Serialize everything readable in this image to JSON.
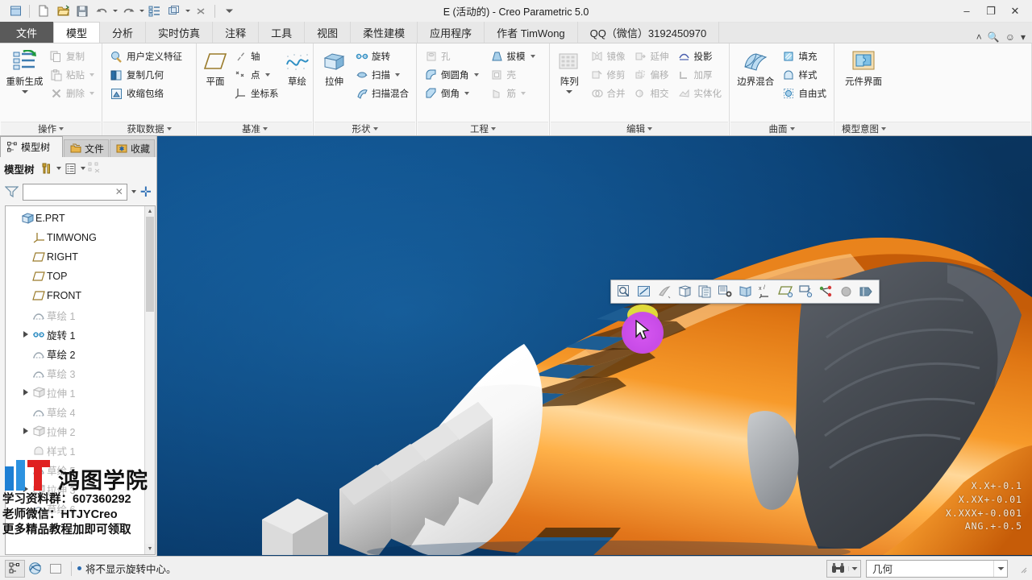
{
  "window": {
    "title": "E (活动的) - Creo Parametric 5.0",
    "minimize": "–",
    "maximize": "❐",
    "close": "✕"
  },
  "quick_access": [
    {
      "name": "app-icon",
      "icon": "cube-icon"
    },
    {
      "name": "new-file",
      "icon": "new-document-icon"
    },
    {
      "name": "open-file",
      "icon": "open-folder-icon"
    },
    {
      "name": "save-file",
      "icon": "save-disk-icon"
    },
    {
      "name": "undo",
      "icon": "undo-arrow-icon"
    },
    {
      "name": "redo",
      "icon": "redo-arrow-icon"
    },
    {
      "name": "regenerate",
      "icon": "regenerate-icon"
    },
    {
      "name": "window-switch",
      "icon": "window-icon"
    },
    {
      "name": "close-window",
      "icon": "close-x-icon"
    },
    {
      "name": "customize-qat",
      "icon": "chevron-down-icon"
    }
  ],
  "tabs": [
    {
      "label": "文件",
      "kind": "file"
    },
    {
      "label": "模型",
      "kind": "active"
    },
    {
      "label": "分析",
      "kind": "normal"
    },
    {
      "label": "实时仿真",
      "kind": "normal"
    },
    {
      "label": "注释",
      "kind": "normal"
    },
    {
      "label": "工具",
      "kind": "normal"
    },
    {
      "label": "视图",
      "kind": "normal"
    },
    {
      "label": "柔性建模",
      "kind": "normal"
    },
    {
      "label": "应用程序",
      "kind": "normal"
    },
    {
      "label": "作者 TimWong",
      "kind": "normal"
    },
    {
      "label": "QQ（微信）3192450970",
      "kind": "normal"
    }
  ],
  "tabbar_right": [
    "˄",
    "🔍",
    "☺",
    "▾"
  ],
  "ribbon": {
    "groups": [
      {
        "title": "操作",
        "big": {
          "label": "重新生成",
          "icon": "regenerate-icon",
          "has_dropdown": true
        },
        "items": [
          {
            "label": "复制",
            "icon": "copy-icon",
            "dimmed": true,
            "dropdown": false
          },
          {
            "label": "粘贴",
            "icon": "paste-icon",
            "dimmed": true,
            "dropdown": true
          },
          {
            "label": "删除",
            "icon": "delete-x-icon",
            "dimmed": true,
            "dropdown": true
          }
        ]
      },
      {
        "title": "获取数据",
        "items": [
          {
            "label": "用户定义特征",
            "icon": "udf-icon",
            "dimmed": false,
            "dropdown": false
          },
          {
            "label": "复制几何",
            "icon": "copy-geometry-icon",
            "dimmed": false,
            "dropdown": false
          },
          {
            "label": "收缩包络",
            "icon": "shrinkwrap-icon",
            "dimmed": false,
            "dropdown": false
          }
        ]
      },
      {
        "title": "基准",
        "big": {
          "label": "平面",
          "icon": "datum-plane-icon",
          "has_dropdown": false
        },
        "items": [
          {
            "label": "轴",
            "icon": "datum-axis-icon",
            "dimmed": false,
            "dropdown": false
          },
          {
            "label": "点",
            "icon": "datum-point-icon",
            "dimmed": false,
            "dropdown": true
          },
          {
            "label": "坐标系",
            "icon": "coordinate-system-icon",
            "dimmed": false,
            "dropdown": false
          }
        ],
        "big2": {
          "label": "草绘",
          "icon": "sketch-curve-icon",
          "has_dropdown": false
        }
      },
      {
        "title": "形状",
        "big": {
          "label": "拉伸",
          "icon": "extrude-icon",
          "has_dropdown": false
        },
        "items": [
          {
            "label": "旋转",
            "icon": "revolve-icon",
            "dimmed": false,
            "dropdown": false
          },
          {
            "label": "扫描",
            "icon": "sweep-icon",
            "dimmed": false,
            "dropdown": true
          },
          {
            "label": "扫描混合",
            "icon": "swept-blend-icon",
            "dimmed": false,
            "dropdown": false
          }
        ]
      },
      {
        "title": "工程",
        "col1": [
          {
            "label": "孔",
            "icon": "hole-icon",
            "dimmed": true,
            "dropdown": false
          },
          {
            "label": "倒圆角",
            "icon": "round-icon",
            "dimmed": false,
            "dropdown": true
          },
          {
            "label": "倒角",
            "icon": "chamfer-icon",
            "dimmed": false,
            "dropdown": true
          }
        ],
        "col2": [
          {
            "label": "拔模",
            "icon": "draft-icon",
            "dimmed": false,
            "dropdown": true
          },
          {
            "label": "壳",
            "icon": "shell-icon",
            "dimmed": true,
            "dropdown": false
          },
          {
            "label": "筋",
            "icon": "rib-icon",
            "dimmed": true,
            "dropdown": true
          }
        ]
      },
      {
        "title": "编辑",
        "big": {
          "label": "阵列",
          "icon": "pattern-icon",
          "has_dropdown": true
        },
        "col1": [
          {
            "label": "镜像",
            "icon": "mirror-icon",
            "dimmed": true,
            "dropdown": false
          },
          {
            "label": "修剪",
            "icon": "trim-icon",
            "dimmed": true,
            "dropdown": false
          },
          {
            "label": "合并",
            "icon": "merge-icon",
            "dimmed": true,
            "dropdown": false
          }
        ],
        "col2": [
          {
            "label": "延伸",
            "icon": "extend-icon",
            "dimmed": true,
            "dropdown": false
          },
          {
            "label": "偏移",
            "icon": "offset-icon",
            "dimmed": true,
            "dropdown": false
          },
          {
            "label": "相交",
            "icon": "intersect-icon",
            "dimmed": true,
            "dropdown": false
          }
        ],
        "col3": [
          {
            "label": "投影",
            "icon": "project-icon",
            "dimmed": false,
            "dropdown": false
          },
          {
            "label": "加厚",
            "icon": "thicken-icon",
            "dimmed": true,
            "dropdown": false
          },
          {
            "label": "实体化",
            "icon": "solidify-icon",
            "dimmed": true,
            "dropdown": false
          }
        ]
      },
      {
        "title": "曲面",
        "big": {
          "label": "边界混合",
          "icon": "boundary-blend-icon",
          "has_dropdown": false
        },
        "items": [
          {
            "label": "填充",
            "icon": "fill-icon",
            "dimmed": false,
            "dropdown": false
          },
          {
            "label": "样式",
            "icon": "style-icon",
            "dimmed": false,
            "dropdown": false
          },
          {
            "label": "自由式",
            "icon": "freestyle-icon",
            "dimmed": false,
            "dropdown": false
          }
        ]
      },
      {
        "title": "模型意图",
        "big": {
          "label": "元件界面",
          "icon": "component-interface-icon",
          "has_dropdown": false
        },
        "items": []
      }
    ]
  },
  "left_panel": {
    "tabs": [
      {
        "label": "模型树",
        "icon": "model-tree-icon",
        "active": true
      },
      {
        "label": "文件",
        "icon": "folder-icon",
        "active": false
      },
      {
        "label": "收藏",
        "icon": "favorites-icon",
        "active": false
      }
    ],
    "toolbar_title": "模型树",
    "filter_placeholder": "",
    "filter_value": "",
    "tree": [
      {
        "label": "E.PRT",
        "icon": "part-cube-icon",
        "indent": 0,
        "dim": false,
        "expand": false
      },
      {
        "label": "TIMWONG",
        "icon": "csys-icon",
        "indent": 1,
        "dim": false,
        "expand": false
      },
      {
        "label": "RIGHT",
        "icon": "datum-plane-icon",
        "indent": 1,
        "dim": false,
        "expand": false
      },
      {
        "label": "TOP",
        "icon": "datum-plane-icon",
        "indent": 1,
        "dim": false,
        "expand": false
      },
      {
        "label": "FRONT",
        "icon": "datum-plane-icon",
        "indent": 1,
        "dim": false,
        "expand": false
      },
      {
        "label": "草绘 1",
        "icon": "sketch-icon",
        "indent": 1,
        "dim": true,
        "expand": false
      },
      {
        "label": "旋转 1",
        "icon": "revolve-icon",
        "indent": 1,
        "dim": false,
        "expand": true
      },
      {
        "label": "草绘 2",
        "icon": "sketch-icon",
        "indent": 1,
        "dim": false,
        "expand": false
      },
      {
        "label": "草绘 3",
        "icon": "sketch-icon",
        "indent": 1,
        "dim": true,
        "expand": false
      },
      {
        "label": "拉伸 1",
        "icon": "extrude-icon",
        "indent": 1,
        "dim": true,
        "expand": true
      },
      {
        "label": "草绘 4",
        "icon": "sketch-icon",
        "indent": 1,
        "dim": true,
        "expand": false
      },
      {
        "label": "拉伸 2",
        "icon": "extrude-icon",
        "indent": 1,
        "dim": true,
        "expand": true
      },
      {
        "label": "样式 1",
        "icon": "style-icon",
        "indent": 1,
        "dim": true,
        "expand": false
      },
      {
        "label": "草绘 5",
        "icon": "sketch-icon",
        "indent": 1,
        "dim": true,
        "expand": false
      },
      {
        "label": "拉伸 3",
        "icon": "extrude-icon",
        "indent": 1,
        "dim": true,
        "expand": true
      },
      {
        "label": "草绘 6",
        "icon": "sketch-icon",
        "indent": 1,
        "dim": true,
        "expand": false
      }
    ]
  },
  "watermark": {
    "logo_text": "鸿图学院",
    "line1": "学习资料群：607360292",
    "line2": "老师微信：HTJYCreo",
    "line3": "更多精品教程加即可领取"
  },
  "graphics_toolbar": [
    {
      "name": "zoom-in-icon"
    },
    {
      "name": "refit-icon"
    },
    {
      "name": "repaint-icon"
    },
    {
      "name": "display-style-icon"
    },
    {
      "name": "saved-views-icon"
    },
    {
      "name": "view-manager-icon"
    },
    {
      "name": "perspective-icon"
    },
    {
      "name": "datum-display-icon"
    },
    {
      "name": "plane-display-icon"
    },
    {
      "name": "point-display-icon"
    },
    {
      "name": "csys-display-icon"
    },
    {
      "name": "spin-center-icon"
    },
    {
      "name": "annotation-display-icon"
    }
  ],
  "viewport": {
    "tolerance_lines": [
      "X.X+-0.1",
      "X.XX+-0.01",
      "X.XXX+-0.001",
      "ANG.+-0.5"
    ],
    "background_color": "#0f5391",
    "model_body_color": "#e87b1e",
    "model_grip_color": "#4a4f55",
    "model_nozzle_color": "#dcdcdc",
    "click_highlight_color": "#c94ce8"
  },
  "statusbar": {
    "message": "将不显示旋转中心。",
    "icons": [
      "datum-display-toggle-icon",
      "spin-center-toggle-icon",
      "selection-box-icon"
    ],
    "search_icon": "binoculars-icon",
    "filter_value": "几何"
  }
}
